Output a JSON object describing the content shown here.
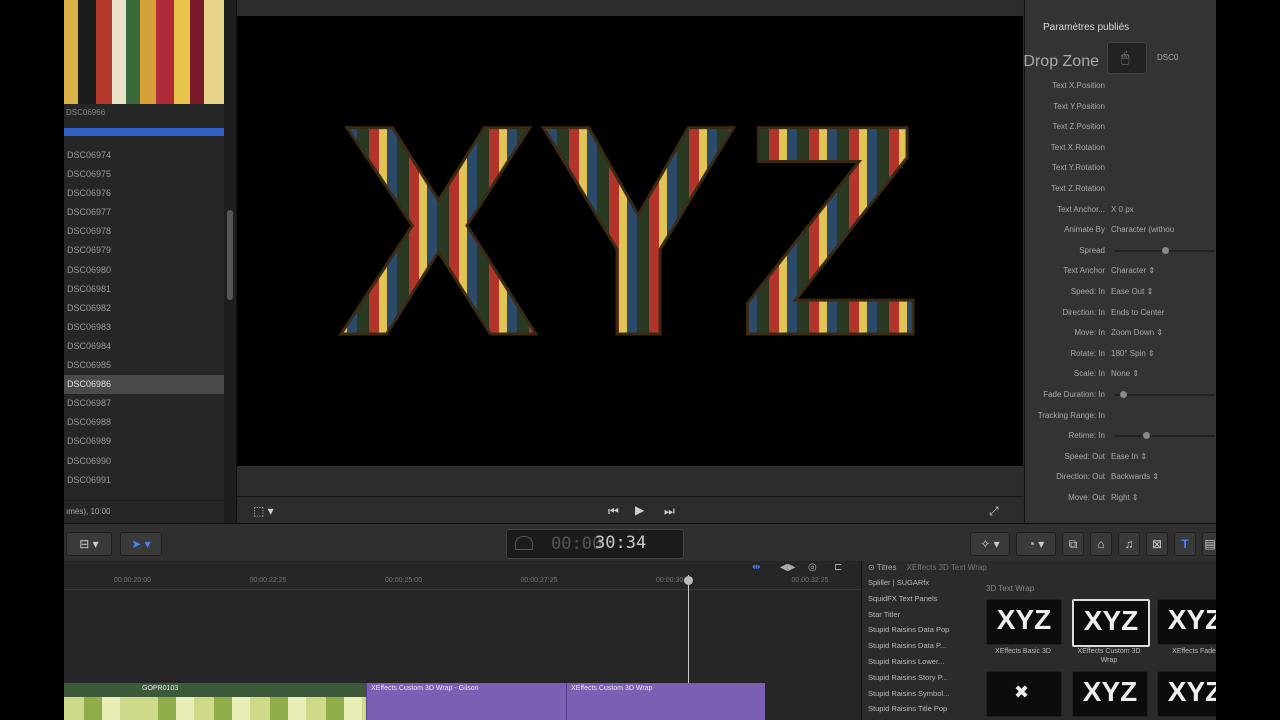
{
  "browser": {
    "group_label": "DSC06966",
    "files": [
      "DSC06974",
      "DSC06975",
      "DSC06976",
      "DSC06977",
      "DSC06978",
      "DSC06979",
      "DSC06980",
      "DSC06981",
      "DSC06982",
      "DSC06983",
      "DSC06984",
      "DSC06985",
      "DSC06986",
      "DSC06987",
      "DSC06988",
      "DSC06989",
      "DSC06990",
      "DSC06991"
    ],
    "selected_file": "DSC06986",
    "status": "ımés), 10:00"
  },
  "viewer": {
    "title_text": "XYZ"
  },
  "inspector": {
    "header": "Paramètres publiés",
    "dropzone_label": "Drop Zone",
    "dropzone_value": "DSC0",
    "rows": [
      {
        "label": "Text X.Position",
        "value": ""
      },
      {
        "label": "Text Y.Position",
        "value": ""
      },
      {
        "label": "Text Z.Position",
        "value": ""
      },
      {
        "label": "Text X.Rotation",
        "value": ""
      },
      {
        "label": "Text Y.Rotation",
        "value": ""
      },
      {
        "label": "Text Z.Rotation",
        "value": ""
      },
      {
        "label": "Text Anchor...",
        "value": "X        0 px"
      },
      {
        "label": "Animate By",
        "value": "Character (withou"
      },
      {
        "label": "Spread",
        "value": "",
        "slider": 0.5
      },
      {
        "label": "Text Anchor",
        "value": "Character  ⇕"
      },
      {
        "label": "Speed: In",
        "value": "Ease Out  ⇕"
      },
      {
        "label": "Direction: In",
        "value": "Ends to Center"
      },
      {
        "label": "Move: In",
        "value": "Zoom Down  ⇕"
      },
      {
        "label": "Rotate: In",
        "value": "180° Spin  ⇕"
      },
      {
        "label": "Scale: In",
        "value": "None  ⇕"
      },
      {
        "label": "Fade Duration: In",
        "value": "",
        "slider": 0.05
      },
      {
        "label": "Tracking Range: In",
        "value": ""
      },
      {
        "label": "Retime: In",
        "value": "",
        "slider": 0.3
      },
      {
        "label": "Speed: Out",
        "value": "Ease In  ⇕"
      },
      {
        "label": "Direction: Out",
        "value": "Backwards  ⇕"
      },
      {
        "label": "Move: Out",
        "value": "Right  ⇕"
      }
    ]
  },
  "toolbar": {
    "timecode_dim": "00:00",
    "timecode_bright": "30:34"
  },
  "timeline": {
    "ruler_labels": [
      "00:00:20:00",
      "00:00:22:25",
      "00:00:25:00",
      "00:00:27:25",
      "00:00:30:00",
      "00:00:32:25"
    ],
    "clips": [
      {
        "label": "",
        "type": "video"
      },
      {
        "label": "GOPR0103",
        "type": "video"
      },
      {
        "label": "XEffects Custom 3D Wrap - Gilson",
        "type": "title"
      },
      {
        "label": "XEffects Custom 3D Wrap",
        "type": "title"
      }
    ]
  },
  "effects": {
    "header": "Titres",
    "header_sub": "XEffects 3D Text Wrap",
    "categories": [
      "Spliller | SUGARfx",
      "SquidFX Text Panels",
      "Star Titler",
      "Stupid Raisins Data Pop",
      "Stupid Raisins Data P...",
      "Stupid Raisins Lower...",
      "Stupid Raisins Story P...",
      "Stupid Raisins Symbol...",
      "Stupid Raisins Title Pop"
    ],
    "grid_title": "3D Text Wrap",
    "tiles": [
      {
        "text": "XYZ",
        "name": "XEffects Basic 3D"
      },
      {
        "text": "XYZ",
        "name": "XEffects Custom 3D Wrap"
      },
      {
        "text": "XYZ",
        "name": "XEffects Fade"
      },
      {
        "text": "",
        "name": ""
      },
      {
        "text": "XYZ",
        "name": ""
      },
      {
        "text": "XYZ",
        "name": ""
      }
    ]
  }
}
